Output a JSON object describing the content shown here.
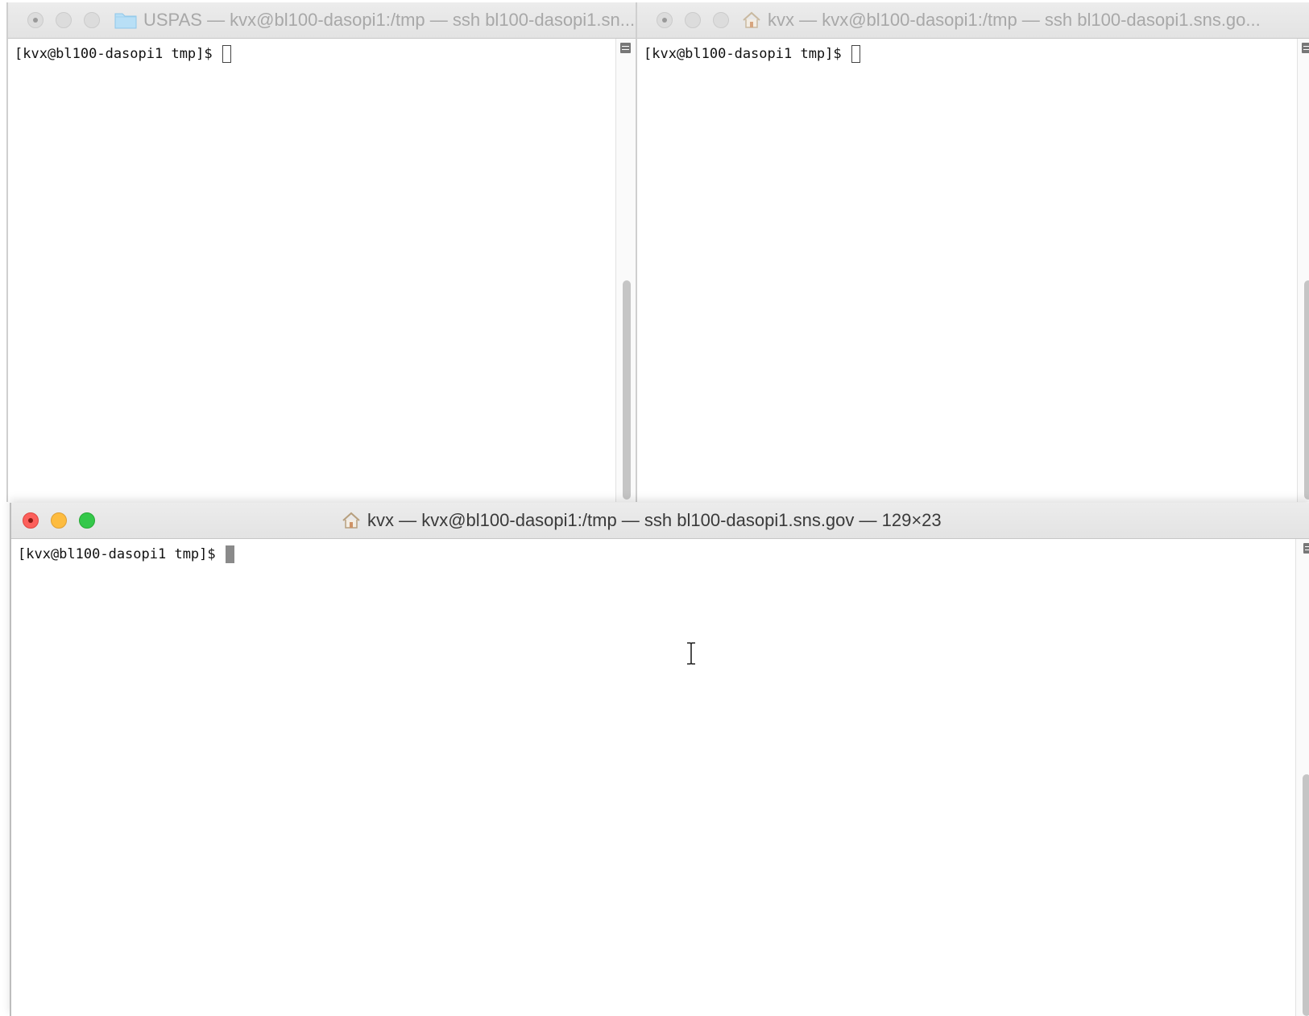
{
  "windows": [
    {
      "title": "USPAS — kvx@bl100-dasopi1:/tmp — ssh bl100-dasopi1.sn...",
      "title_icon": "folder-icon",
      "prompt": "[kvx@bl100-dasopi1 tmp]$ ",
      "focused": false,
      "scroll_position": 0.55
    },
    {
      "title": "kvx — kvx@bl100-dasopi1:/tmp — ssh bl100-dasopi1.sns.go...",
      "title_icon": "home-icon",
      "prompt": "[kvx@bl100-dasopi1 tmp]$ ",
      "focused": false,
      "scroll_position": 0.55
    },
    {
      "title": "kvx — kvx@bl100-dasopi1:/tmp — ssh bl100-dasopi1.sns.gov — 129×23",
      "title_icon": "home-icon",
      "prompt": "[kvx@bl100-dasopi1 tmp]$ ",
      "focused": true,
      "scroll_position": 0.55
    }
  ],
  "colors": {
    "close": "#fc605c",
    "minimize": "#fdbc40",
    "zoom": "#34c84a",
    "inactive_title": "#a8a8a8",
    "active_title": "#3a3a3a"
  }
}
